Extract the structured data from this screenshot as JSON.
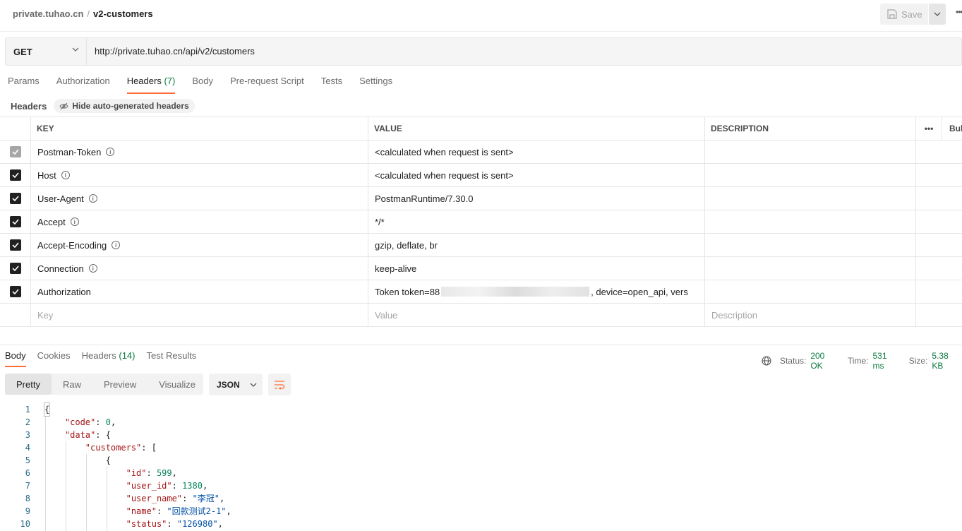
{
  "breadcrumb": {
    "parent": "private.tuhao.cn",
    "separator": "/",
    "current": "v2-customers"
  },
  "toolbar": {
    "save_label": "Save"
  },
  "request": {
    "method": "GET",
    "url": "http://private.tuhao.cn/api/v2/customers"
  },
  "request_tabs": [
    {
      "label": "Params"
    },
    {
      "label": "Authorization"
    },
    {
      "label": "Headers",
      "count": "(7)"
    },
    {
      "label": "Body"
    },
    {
      "label": "Pre-request Script"
    },
    {
      "label": "Tests"
    },
    {
      "label": "Settings"
    }
  ],
  "headers_section": {
    "label": "Headers",
    "hide_auto_label": "Hide auto-generated headers"
  },
  "table": {
    "columns": {
      "key": "KEY",
      "value": "VALUE",
      "description": "DESCRIPTION",
      "bulk": "Bulk Edit"
    },
    "rows": [
      {
        "key": "Postman-Token",
        "value": "<calculated when request is sent>",
        "locked": true
      },
      {
        "key": "Host",
        "value": "<calculated when request is sent>"
      },
      {
        "key": "User-Agent",
        "value": "PostmanRuntime/7.30.0"
      },
      {
        "key": "Accept",
        "value": "*/*"
      },
      {
        "key": "Accept-Encoding",
        "value": "gzip, deflate, br"
      },
      {
        "key": "Connection",
        "value": "keep-alive"
      }
    ],
    "auth_row": {
      "key": "Authorization",
      "value_prefix": "Token token=88",
      "value_suffix": ", device=open_api, vers"
    },
    "placeholders": {
      "key": "Key",
      "value": "Value",
      "description": "Description"
    }
  },
  "response_tabs": [
    {
      "label": "Body"
    },
    {
      "label": "Cookies"
    },
    {
      "label": "Headers",
      "count": "(14)"
    },
    {
      "label": "Test Results"
    }
  ],
  "status": {
    "status_label": "Status:",
    "status_value": "200 OK",
    "time_label": "Time:",
    "time_value": "531 ms",
    "size_label": "Size:",
    "size_value": "5.38 KB"
  },
  "view_modes": [
    "Pretty",
    "Raw",
    "Preview",
    "Visualize"
  ],
  "format": "JSON",
  "code_lines": [
    "1",
    "2",
    "3",
    "4",
    "5",
    "6",
    "7",
    "8",
    "9",
    "10"
  ],
  "code": {
    "code_key": "\"code\"",
    "code_val": "0",
    "data_key": "\"data\"",
    "customers_key": "\"customers\"",
    "id_key": "\"id\"",
    "id_val": "599",
    "user_id_key": "\"user_id\"",
    "user_id_val": "1380",
    "user_name_key": "\"user_name\"",
    "user_name_val": "\"李冠\"",
    "name_key": "\"name\"",
    "name_val": "\"回款测试2-1\"",
    "status_key": "\"status\"",
    "status_val": "\"126980\""
  },
  "colors": {
    "accent": "#ff6c37",
    "status_green": "#0c7a3e"
  }
}
